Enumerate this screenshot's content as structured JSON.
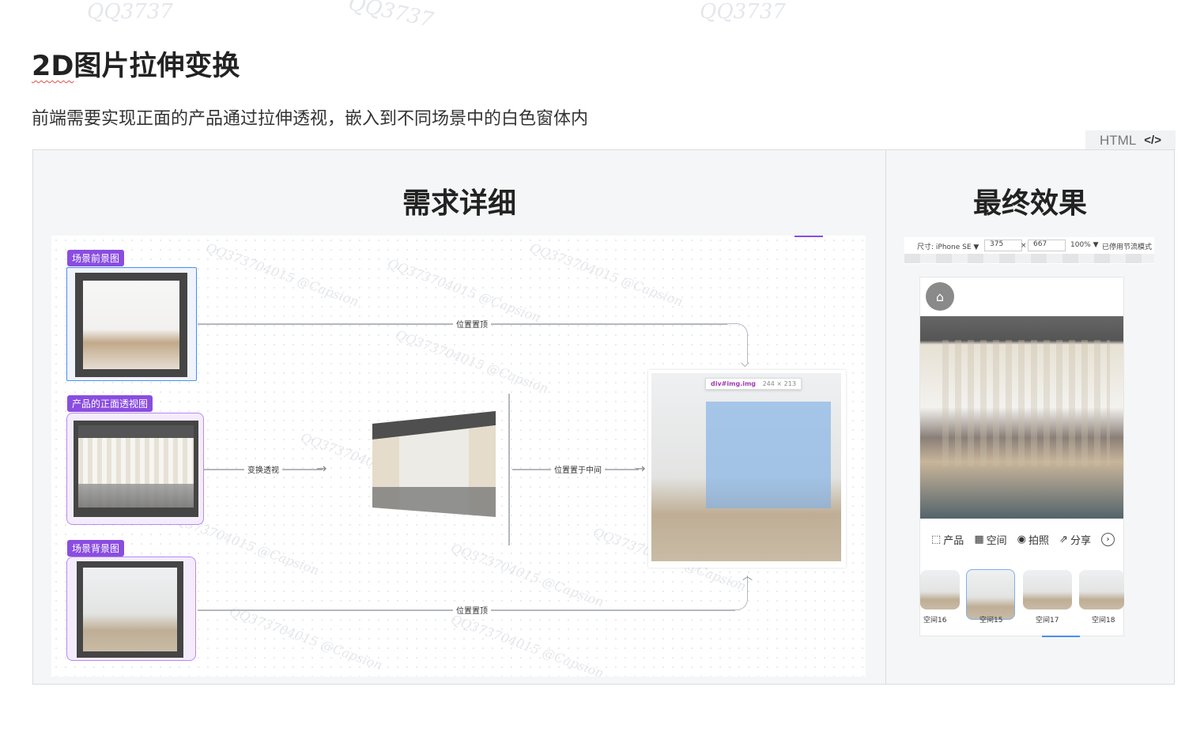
{
  "page": {
    "title_prefix": "2D",
    "title_rest": "图片拉伸变换",
    "subtitle": "前端需要实现正面的产品通过拉伸透视，嵌入到不同场景中的白色窗体内",
    "code_tab": "HTML",
    "watermark": "QQ3737"
  },
  "left_panel": {
    "title": "需求详细",
    "tags": [
      "场景前景图",
      "产品的正面透视图",
      "场景背景图"
    ],
    "edges": [
      "位置置顶",
      "变换透视",
      "位置置于中间",
      "位置置顶"
    ],
    "inspector": {
      "selector": "div#img.img",
      "size": "244 × 213"
    },
    "watermark": "QQ373704015 @Capsion"
  },
  "right_panel": {
    "title": "最终效果",
    "device_bar": {
      "device": "尺寸: iPhone SE ▼",
      "width": "375",
      "x": "×",
      "height": "667",
      "zoom": "100% ▼",
      "mode": "已停用节流模式"
    },
    "toolbar": [
      {
        "icon": "product-icon",
        "label": "产品"
      },
      {
        "icon": "space-icon",
        "label": "空间"
      },
      {
        "icon": "camera-icon",
        "label": "拍照"
      },
      {
        "icon": "share-icon",
        "label": "分享"
      }
    ],
    "rooms": [
      "空间16",
      "空间15",
      "空间17",
      "空间18"
    ]
  }
}
